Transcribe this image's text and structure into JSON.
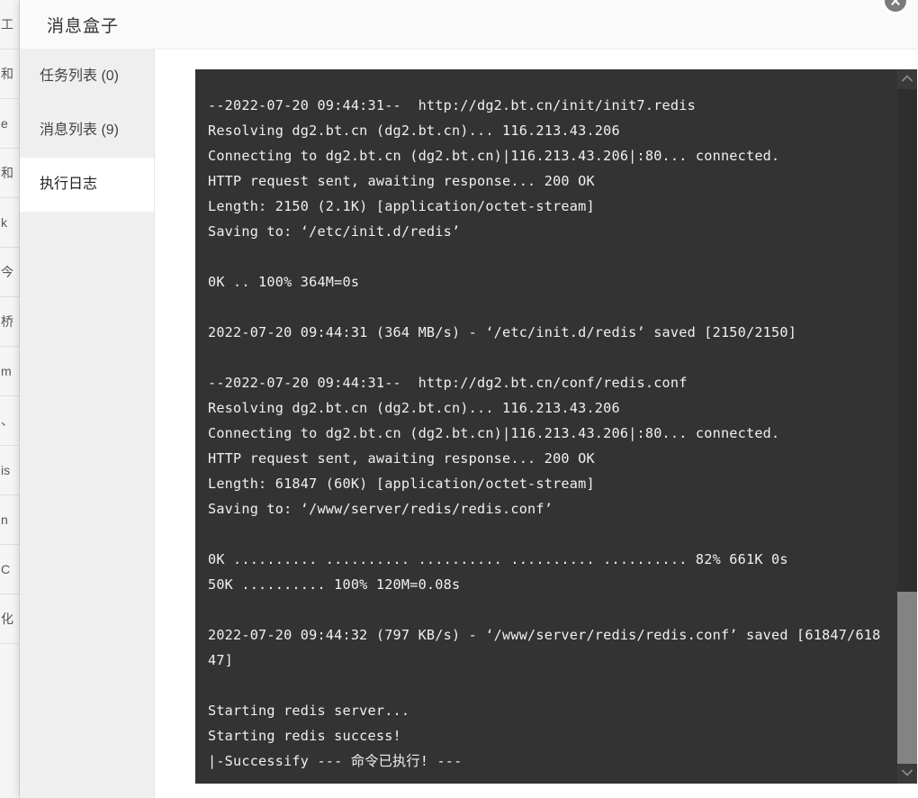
{
  "background_page": {
    "rows": [
      "工",
      "和",
      "e",
      "和",
      "k",
      "今",
      "桥",
      "m",
      "、",
      "is",
      "n",
      "C",
      "化"
    ]
  },
  "modal": {
    "title": "消息盒子",
    "close_icon": "close-icon",
    "tabs": [
      {
        "label": "任务列表 (0)",
        "name": "tab-task-list",
        "active": false
      },
      {
        "label": "消息列表 (9)",
        "name": "tab-message-list",
        "active": false
      },
      {
        "label": "执行日志",
        "name": "tab-execution-log",
        "active": true
      }
    ]
  },
  "terminal": {
    "log": "--2022-07-20 09:44:31--  http://dg2.bt.cn/init/init7.redis\nResolving dg2.bt.cn (dg2.bt.cn)... 116.213.43.206\nConnecting to dg2.bt.cn (dg2.bt.cn)|116.213.43.206|:80... connected.\nHTTP request sent, awaiting response... 200 OK\nLength: 2150 (2.1K) [application/octet-stream]\nSaving to: ‘/etc/init.d/redis’\n\n0K .. 100% 364M=0s\n\n2022-07-20 09:44:31 (364 MB/s) - ‘/etc/init.d/redis’ saved [2150/2150]\n\n--2022-07-20 09:44:31--  http://dg2.bt.cn/conf/redis.conf\nResolving dg2.bt.cn (dg2.bt.cn)... 116.213.43.206\nConnecting to dg2.bt.cn (dg2.bt.cn)|116.213.43.206|:80... connected.\nHTTP request sent, awaiting response... 200 OK\nLength: 61847 (60K) [application/octet-stream]\nSaving to: ‘/www/server/redis/redis.conf’\n\n0K .......... .......... .......... .......... .......... 82% 661K 0s\n50K .......... 100% 120M=0.08s\n\n2022-07-20 09:44:32 (797 KB/s) - ‘/www/server/redis/redis.conf’ saved [61847/61847]\n\nStarting redis server...\nStarting redis success!\n|-Successify --- 命令已执行! ---"
  },
  "scrollbar": {
    "up_icon": "chevron-up-icon",
    "down_icon": "chevron-down-icon"
  },
  "colors": {
    "terminal_bg": "#333333",
    "terminal_text": "#f0f0f0",
    "sidebar_bg": "#efefef",
    "header_bg": "#fafafa",
    "scroll_thumb": "#838383"
  }
}
